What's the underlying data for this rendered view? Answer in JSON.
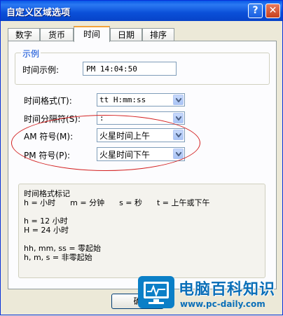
{
  "window": {
    "title": "自定义区域选项"
  },
  "titlebar_buttons": {
    "help": "?",
    "close": "✕"
  },
  "tabs": [
    {
      "label": "数字"
    },
    {
      "label": "货币"
    },
    {
      "label": "时间"
    },
    {
      "label": "日期"
    },
    {
      "label": "排序"
    }
  ],
  "example": {
    "group_title": "示例",
    "label": "时间示例:",
    "value": "PM 14:04:50"
  },
  "fields": [
    {
      "label": "时间格式(T):",
      "value": "tt H:mm:ss"
    },
    {
      "label": "时间分隔符(S):",
      "value": ":"
    },
    {
      "label": "AM 符号(M):",
      "value": "火星时间上午"
    },
    {
      "label": "PM 符号(P):",
      "value": "火星时间下午"
    }
  ],
  "legend": {
    "lines": [
      "时间格式标记",
      "h = 小时      m = 分钟      s = 秒      t = 上午或下午",
      "",
      "h = 12 小时",
      "H = 24 小时",
      "",
      "hh, mm, ss = 零起始",
      "h, m, s = 非零起始"
    ]
  },
  "buttons": {
    "ok": "确"
  },
  "watermark": {
    "name": "电脑百科知识",
    "url": "www.pc-daily.com"
  },
  "colors": {
    "title_bar": "#0a5ae8",
    "annotation": "#d32020",
    "accent_tab": "#f2a33a"
  }
}
